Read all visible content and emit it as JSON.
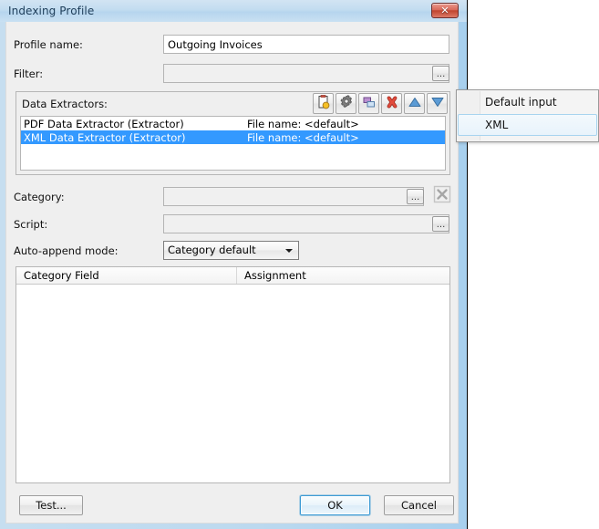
{
  "window": {
    "title": "Indexing Profile",
    "close_label": "✕"
  },
  "form": {
    "profile_name_label": "Profile name:",
    "profile_name_value": "Outgoing Invoices",
    "filter_label": "Filter:",
    "filter_value": "",
    "filter_browse_label": "...",
    "category_label": "Category:",
    "category_value": "",
    "category_browse_label": "...",
    "category_clear_icon": "clear-x-icon",
    "script_label": "Script:",
    "script_value": "",
    "script_browse_label": "...",
    "auto_append_label": "Auto-append mode:",
    "auto_append_value": "Category default"
  },
  "extractors": {
    "group_label": "Data Extractors:",
    "toolbar": [
      {
        "name": "new-extractor-icon",
        "tooltip": "New"
      },
      {
        "name": "settings-gear-icon",
        "tooltip": "Settings"
      },
      {
        "name": "copy-duplicate-icon",
        "tooltip": "Copy"
      },
      {
        "name": "delete-red-x-icon",
        "tooltip": "Delete"
      },
      {
        "name": "move-up-arrow-icon",
        "tooltip": "Move up"
      },
      {
        "name": "move-down-arrow-icon",
        "tooltip": "Move down"
      }
    ],
    "rows": [
      {
        "name": "PDF Data Extractor (Extractor)",
        "file": "File name: <default>",
        "selected": false
      },
      {
        "name": "XML Data Extractor (Extractor)",
        "file": "File name: <default>",
        "selected": true
      }
    ]
  },
  "grid": {
    "columns": [
      "Category Field",
      "Assignment"
    ],
    "rows": []
  },
  "buttons": {
    "test": "Test...",
    "ok": "OK",
    "cancel": "Cancel"
  },
  "popup_menu": {
    "items": [
      {
        "label": "Default input",
        "hover": false
      },
      {
        "label": "XML",
        "hover": true
      }
    ]
  },
  "colors": {
    "selection_blue": "#3399ff",
    "title_blue": "#1d3d59",
    "close_red": "#c0452f",
    "default_button_border": "#3c9ad4"
  }
}
